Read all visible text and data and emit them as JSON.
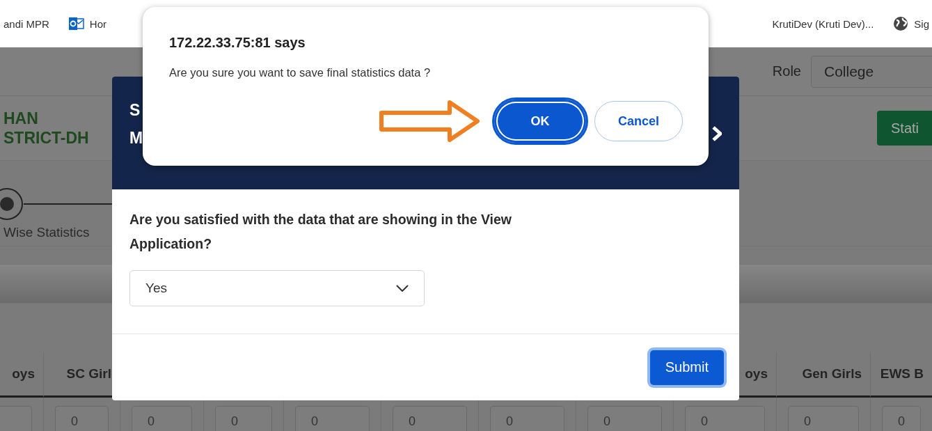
{
  "bookmarks": [
    {
      "label": "andi MPR",
      "kind": "plain"
    },
    {
      "label": "Hor",
      "kind": "mail"
    },
    {
      "label": "KrutiDev (Kruti Dev)...",
      "kind": "plain"
    },
    {
      "label": "Sig",
      "kind": "globe"
    }
  ],
  "header": {
    "role_label": "Role",
    "role_value": "College",
    "title_lines": [
      "HAN",
      "STRICT-DH"
    ],
    "action_button": "Stati"
  },
  "stepper": {
    "label": "Wise Statistics"
  },
  "table": {
    "columns": [
      {
        "label": "oys"
      },
      {
        "label": "SC Girl"
      },
      {},
      {},
      {},
      {},
      {},
      {},
      {
        "label": "oys"
      },
      {
        "label": "Gen Girls"
      },
      {
        "label": "EWS B"
      }
    ],
    "row_values": [
      "0",
      "0",
      "0",
      "0",
      "0",
      "0",
      "0",
      "0",
      "0",
      "0"
    ]
  },
  "modal": {
    "title_lines": [
      "S",
      "M"
    ],
    "question": "Are you satisfied with the data that are showing in the View Application?",
    "select_value": "Yes",
    "submit": "Submit"
  },
  "alert": {
    "title": "172.22.33.75:81 says",
    "message": "Are you sure you want to save final statistics data ?",
    "ok": "OK",
    "cancel": "Cancel",
    "ok_focused": true
  }
}
